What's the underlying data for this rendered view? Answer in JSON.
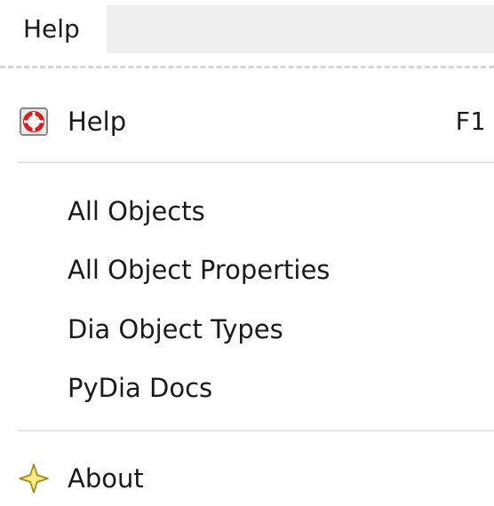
{
  "menubar": {
    "title": "Help"
  },
  "menu": {
    "items": [
      {
        "label": "Help",
        "accelerator": "F1",
        "icon": "lifebuoy-icon"
      },
      {
        "label": "All Objects"
      },
      {
        "label": "All Object Properties"
      },
      {
        "label": "Dia Object Types"
      },
      {
        "label": "PyDia Docs"
      },
      {
        "label": "About",
        "icon": "star-icon"
      }
    ]
  },
  "colors": {
    "menubar_strip": "#efefef",
    "separator": "#e4e4e4",
    "help_icon_red": "#d42020",
    "about_icon_yellow": "#f2d33a"
  }
}
